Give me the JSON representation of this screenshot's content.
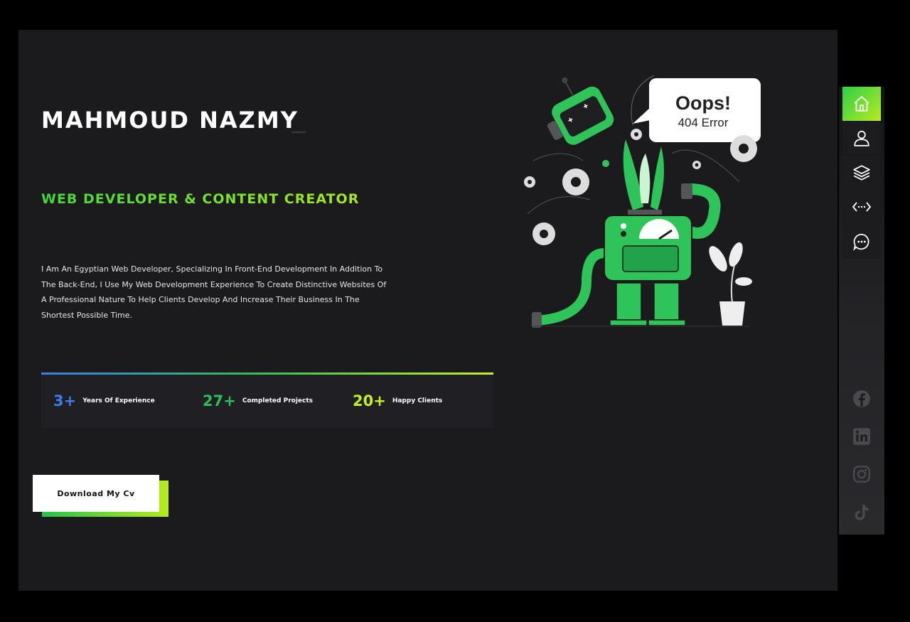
{
  "hero": {
    "name": "MAHMOUD NAZMY",
    "role": "WEB DEVELOPER & CONTENT CREATOR",
    "bio": "I Am An Egyptian Web Developer, Specializing In Front-End Development In Addition To The Back-End, I Use My Web Development Experience To Create Distinctive Websites Of A Professional Nature To Help Clients Develop And Increase Their Business In The Shortest Possible Time."
  },
  "stats": [
    {
      "value": "3+",
      "label": "Years Of Experience",
      "color": "#3d7dea"
    },
    {
      "value": "27+",
      "label": "Completed Projects",
      "color": "#2fbd5a"
    },
    {
      "value": "20+",
      "label": "Happy Clients",
      "color": "#c6f01b"
    }
  ],
  "cv_button": {
    "label": "Download My Cv"
  },
  "illustration": {
    "bubble_title": "Oops!",
    "bubble_text": "404 Error"
  },
  "nav": [
    {
      "icon": "home-icon",
      "active": true
    },
    {
      "icon": "user-icon",
      "active": false
    },
    {
      "icon": "layers-icon",
      "active": false
    },
    {
      "icon": "code-icon",
      "active": false
    },
    {
      "icon": "chat-icon",
      "active": false
    }
  ],
  "socials": [
    "facebook-icon",
    "linkedin-icon",
    "instagram-icon",
    "tiktok-icon"
  ],
  "colors": {
    "accent_green": "#2ecf4a",
    "accent_lime": "#b6ec1c",
    "robot_green": "#2ec45a",
    "panel": "#1b1b1e"
  }
}
